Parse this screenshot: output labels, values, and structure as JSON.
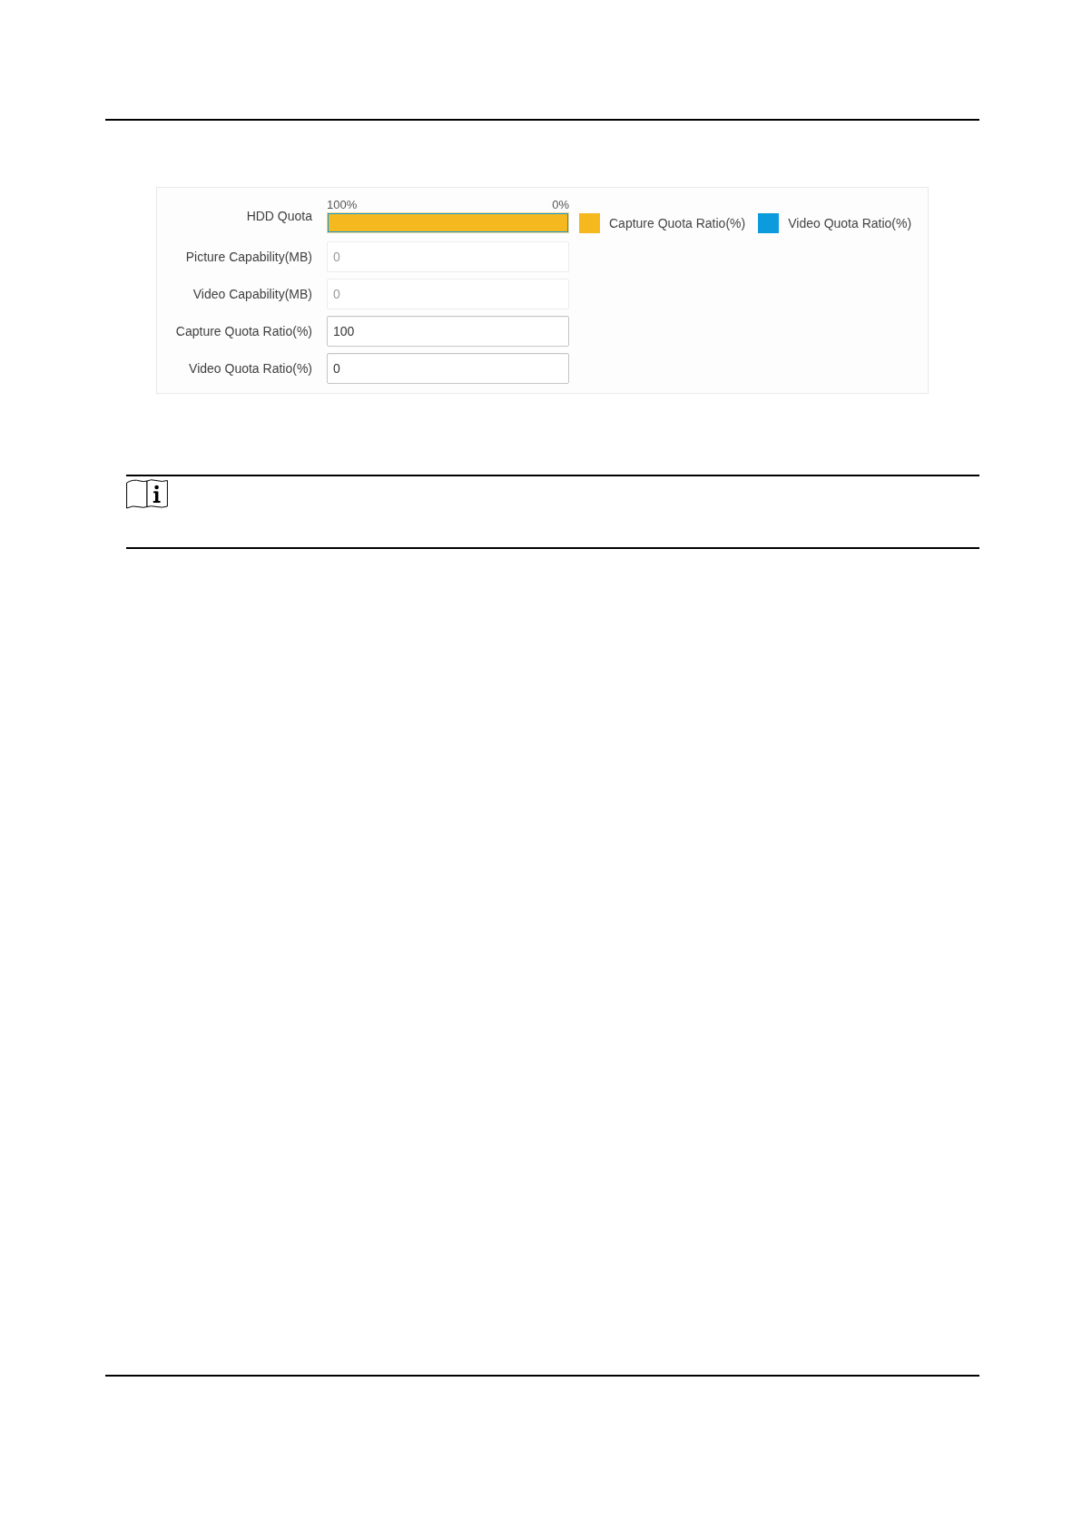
{
  "hdd_quota": {
    "label": "HDD Quota",
    "scale_start": "100%",
    "scale_end": "0%",
    "level": 1
  },
  "legend": [
    {
      "label": "Capture Quota Ratio(%)",
      "color": "#f6b81f"
    },
    {
      "label": "Video Quota Ratio(%)",
      "color": "#0c9bdc"
    }
  ],
  "fields": [
    {
      "label": "Picture Capability(MB)",
      "value": "0",
      "disabled": true
    },
    {
      "label": "Video Capability(MB)",
      "value": "0",
      "disabled": true
    },
    {
      "label": "Capture Quota Ratio(%)",
      "value": "100",
      "disabled": false
    },
    {
      "label": "Video Quota Ratio(%)",
      "value": "0",
      "disabled": false
    }
  ]
}
